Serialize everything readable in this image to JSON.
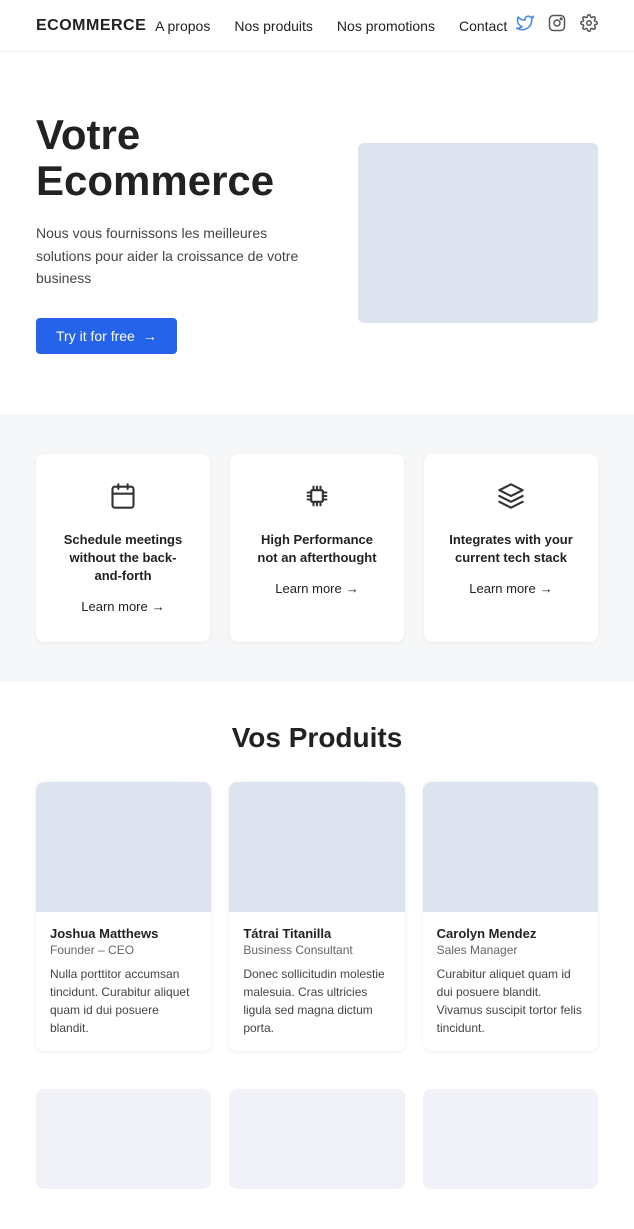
{
  "nav": {
    "logo": "ECOMMERCE",
    "links": [
      {
        "id": "a-propos",
        "label": "A propos"
      },
      {
        "id": "nos-produits",
        "label": "Nos produits"
      },
      {
        "id": "nos-promotions",
        "label": "Nos promotions"
      },
      {
        "id": "contact",
        "label": "Contact"
      }
    ],
    "icons": [
      {
        "id": "twitter-icon",
        "glyph": "𝕏"
      },
      {
        "id": "instagram-icon",
        "glyph": "◻"
      },
      {
        "id": "settings-icon",
        "glyph": "✳"
      }
    ]
  },
  "hero": {
    "title": "Votre Ecommerce",
    "subtitle": "Nous vous fournissons les meilleures solutions pour aider la croissance de votre business",
    "button_label": "Try it for free",
    "button_arrow": "→"
  },
  "features": [
    {
      "id": "feature-schedule",
      "icon": "📅",
      "title": "Schedule meetings without the back-and-forth",
      "link": "Learn more",
      "arrow": "→"
    },
    {
      "id": "feature-performance",
      "icon": "⚙",
      "title": "High Performance not an afterthought",
      "link": "Learn more",
      "arrow": "→"
    },
    {
      "id": "feature-integrates",
      "icon": "⬡",
      "title": "Integrates with your current tech stack",
      "link": "Learn more",
      "arrow": "→"
    }
  ],
  "products_section": {
    "title": "Vos Produits",
    "cards": [
      {
        "id": "card-joshua",
        "name": "Joshua Matthews",
        "role": "Founder – CEO",
        "desc": "Nulla porttitor accumsan tincidunt. Curabitur aliquet quam id dui posuere blandit."
      },
      {
        "id": "card-tatrai",
        "name": "Tátrai Titanilla",
        "role": "Business Consultant",
        "desc": "Donec sollicitudin molestie malesuia. Cras ultricies ligula sed magna dictum porta."
      },
      {
        "id": "card-carolyn",
        "name": "Carolyn Mendez",
        "role": "Sales Manager",
        "desc": "Curabitur aliquet quam id dui posuere blandit. Vivamus suscipit tortor felis tincidunt."
      }
    ]
  },
  "bottom_row": {
    "cards": [
      {
        "id": "bottom-1"
      },
      {
        "id": "bottom-2"
      },
      {
        "id": "bottom-3"
      }
    ]
  }
}
